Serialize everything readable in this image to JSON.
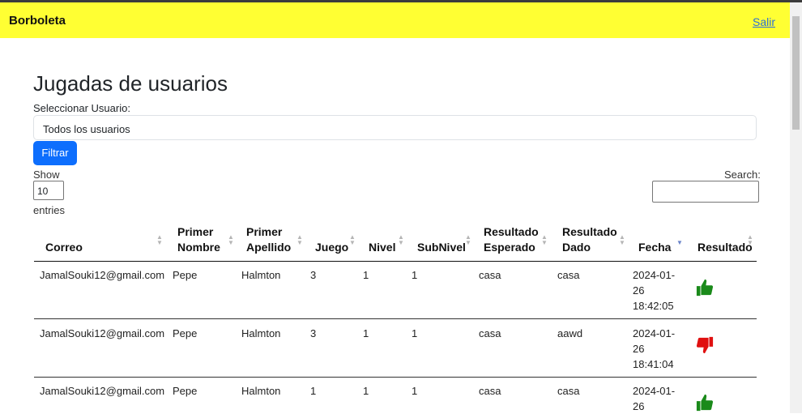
{
  "navbar": {
    "brand": "Borboleta",
    "logout": "Salir"
  },
  "page": {
    "title": "Jugadas de usuarios",
    "select_label": "Seleccionar Usuario:",
    "select_value": "Todos los usuarios",
    "filter_button": "Filtrar"
  },
  "datatable": {
    "show_label": "Show",
    "entries_label": "entries",
    "length_value": "10",
    "search_label": "Search:",
    "search_value": ""
  },
  "table": {
    "headers": [
      "Correo",
      "Primer",
      "Nombre",
      "Primer",
      "Apellido",
      "Juego",
      "Nivel",
      "SubNivel",
      "Resultado",
      "Esperado",
      "Resultado",
      "Dado",
      "Fecha",
      "Resultado"
    ],
    "sorted_column": "Fecha",
    "rows": [
      {
        "correo": "JamalSouki12@gmail.com",
        "nombre": "Pepe",
        "apellido": "Halmton",
        "juego": "3",
        "nivel": "1",
        "subnivel": "1",
        "esperado": "casa",
        "dado": "casa",
        "fecha_l1": "2024-01-",
        "fecha_l2": "26",
        "fecha_l3": "18:42:05",
        "resultado_icon": "thumbs-up-icon"
      },
      {
        "correo": "JamalSouki12@gmail.com",
        "nombre": "Pepe",
        "apellido": "Halmton",
        "juego": "3",
        "nivel": "1",
        "subnivel": "1",
        "esperado": "casa",
        "dado": "aawd",
        "fecha_l1": "2024-01-",
        "fecha_l2": "26",
        "fecha_l3": "18:41:04",
        "resultado_icon": "thumbs-down-icon"
      },
      {
        "correo": "JamalSouki12@gmail.com",
        "nombre": "Pepe",
        "apellido": "Halmton",
        "juego": "1",
        "nivel": "1",
        "subnivel": "1",
        "esperado": "casa",
        "dado": "casa",
        "fecha_l1": "2024-01-",
        "fecha_l2": "26",
        "fecha_l3": "",
        "resultado_icon": "thumbs-up-icon"
      }
    ]
  },
  "colors": {
    "navbar": "#ffff33",
    "primary_button": "#0d6efd",
    "thumb_up": "#1a8a1a",
    "thumb_down": "#e01010"
  }
}
